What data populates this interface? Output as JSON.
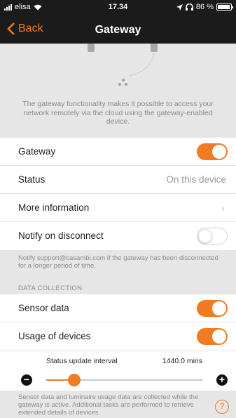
{
  "status_bar": {
    "carrier": "elisa",
    "time": "17.34",
    "battery": "86 %"
  },
  "nav": {
    "back_label": "Back",
    "title": "Gateway"
  },
  "description": "The gateway functionality makes it possible to access your network remotely via the cloud using the gateway-enabled device.",
  "rows": {
    "gateway": {
      "label": "Gateway",
      "enabled": true
    },
    "status": {
      "label": "Status",
      "value": "On this device"
    },
    "more_info": {
      "label": "More information",
      "chevron": "›"
    },
    "notify": {
      "label": "Notify on disconnect",
      "enabled": false
    }
  },
  "notify_note": "Notify support@casambi.com if the gateway has been disconnected for a longer period of time.",
  "data_collection": {
    "header": "DATA COLLECTION",
    "sensor": {
      "label": "Sensor data",
      "enabled": true
    },
    "usage": {
      "label": "Usage of devices",
      "enabled": true
    }
  },
  "interval": {
    "label": "Status update interval",
    "value": "1440.0 mins",
    "position": 0.18,
    "minus": "−",
    "plus": "+"
  },
  "footnote": "Sensor data and luminaire usage data are collected while the gateway is active. Additional tasks are performed to retrieve extended details of devices.",
  "help_label": "?",
  "colors": {
    "accent": "#f07b22",
    "nav_bg": "#1b1b1b",
    "page_bg": "#e6e6e6"
  }
}
